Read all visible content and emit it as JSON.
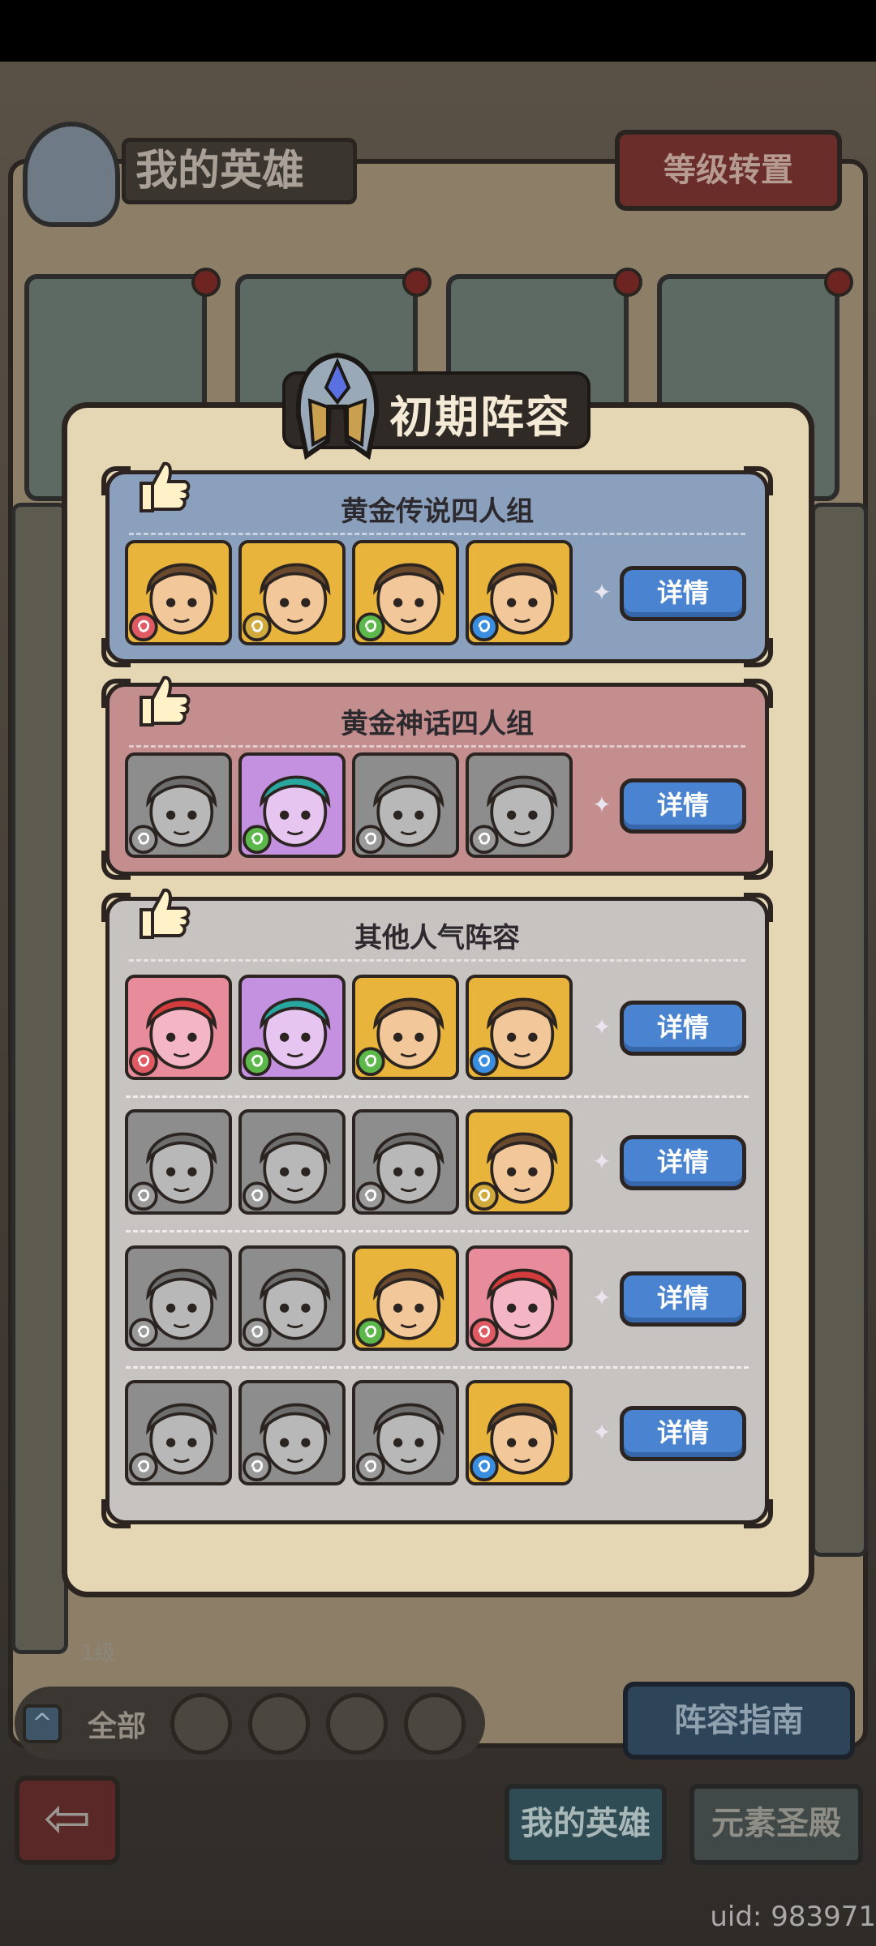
{
  "background": {
    "title": "我的英雄",
    "top_right_button": "等级转置",
    "hero_level": "1级",
    "filter_all": "全部",
    "guide_button": "阵容指南",
    "tabs": [
      "我的英雄",
      "元素圣殿"
    ]
  },
  "dialog": {
    "title": "初期阵容",
    "groups": [
      {
        "title": "黄金传说四人组",
        "rows": [
          {
            "heroes": [
              "gold",
              "gold",
              "gold",
              "gold"
            ],
            "elements": [
              "fire",
              "earth",
              "nature",
              "water"
            ],
            "button": "详情"
          }
        ]
      },
      {
        "title": "黄金神话四人组",
        "rows": [
          {
            "heroes": [
              "gray",
              "purple",
              "gray",
              "gray"
            ],
            "elements": [
              "earth",
              "nature",
              "earth",
              "nature"
            ],
            "button": "详情"
          }
        ]
      },
      {
        "title": "其他人气阵容",
        "rows": [
          {
            "heroes": [
              "pink",
              "purple",
              "gold",
              "gold"
            ],
            "elements": [
              "fire",
              "nature",
              "nature",
              "water"
            ],
            "button": "详情"
          },
          {
            "heroes": [
              "gray",
              "gray",
              "gray",
              "gold"
            ],
            "elements": [
              "fire",
              "earth",
              "earth",
              "earth"
            ],
            "button": "详情"
          },
          {
            "heroes": [
              "gray",
              "gray",
              "gold",
              "pink"
            ],
            "elements": [
              "earth",
              "fire",
              "nature",
              "fire"
            ],
            "button": "详情"
          },
          {
            "heroes": [
              "gray",
              "gray",
              "gray",
              "gold"
            ],
            "elements": [
              "earth",
              "water",
              "earth",
              "water"
            ],
            "button": "详情"
          }
        ]
      }
    ]
  },
  "watermark": "uid: 983971",
  "colors": {
    "detail_button": "#4a83cf",
    "legend_panel": "#8aa0bc",
    "myth_panel": "#c48e8f",
    "other_panel": "#c7c3c0",
    "dialog": "#e6d7b4"
  }
}
